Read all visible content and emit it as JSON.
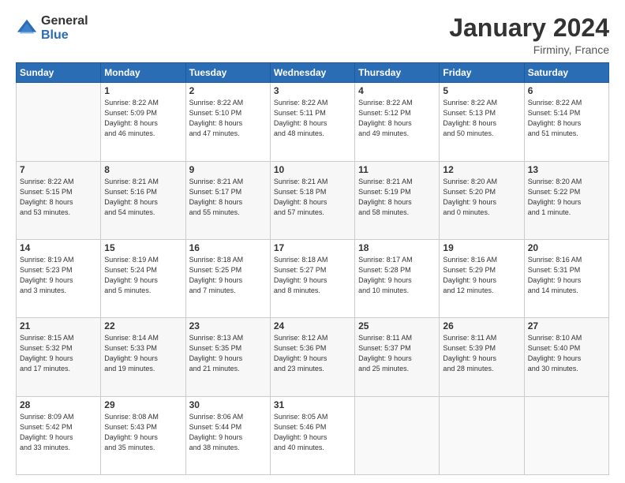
{
  "logo": {
    "general": "General",
    "blue": "Blue"
  },
  "header": {
    "month": "January 2024",
    "location": "Firminy, France"
  },
  "days_of_week": [
    "Sunday",
    "Monday",
    "Tuesday",
    "Wednesday",
    "Thursday",
    "Friday",
    "Saturday"
  ],
  "weeks": [
    [
      {
        "day": "",
        "info": ""
      },
      {
        "day": "1",
        "info": "Sunrise: 8:22 AM\nSunset: 5:09 PM\nDaylight: 8 hours\nand 46 minutes."
      },
      {
        "day": "2",
        "info": "Sunrise: 8:22 AM\nSunset: 5:10 PM\nDaylight: 8 hours\nand 47 minutes."
      },
      {
        "day": "3",
        "info": "Sunrise: 8:22 AM\nSunset: 5:11 PM\nDaylight: 8 hours\nand 48 minutes."
      },
      {
        "day": "4",
        "info": "Sunrise: 8:22 AM\nSunset: 5:12 PM\nDaylight: 8 hours\nand 49 minutes."
      },
      {
        "day": "5",
        "info": "Sunrise: 8:22 AM\nSunset: 5:13 PM\nDaylight: 8 hours\nand 50 minutes."
      },
      {
        "day": "6",
        "info": "Sunrise: 8:22 AM\nSunset: 5:14 PM\nDaylight: 8 hours\nand 51 minutes."
      }
    ],
    [
      {
        "day": "7",
        "info": "Sunrise: 8:22 AM\nSunset: 5:15 PM\nDaylight: 8 hours\nand 53 minutes."
      },
      {
        "day": "8",
        "info": "Sunrise: 8:21 AM\nSunset: 5:16 PM\nDaylight: 8 hours\nand 54 minutes."
      },
      {
        "day": "9",
        "info": "Sunrise: 8:21 AM\nSunset: 5:17 PM\nDaylight: 8 hours\nand 55 minutes."
      },
      {
        "day": "10",
        "info": "Sunrise: 8:21 AM\nSunset: 5:18 PM\nDaylight: 8 hours\nand 57 minutes."
      },
      {
        "day": "11",
        "info": "Sunrise: 8:21 AM\nSunset: 5:19 PM\nDaylight: 8 hours\nand 58 minutes."
      },
      {
        "day": "12",
        "info": "Sunrise: 8:20 AM\nSunset: 5:20 PM\nDaylight: 9 hours\nand 0 minutes."
      },
      {
        "day": "13",
        "info": "Sunrise: 8:20 AM\nSunset: 5:22 PM\nDaylight: 9 hours\nand 1 minute."
      }
    ],
    [
      {
        "day": "14",
        "info": "Sunrise: 8:19 AM\nSunset: 5:23 PM\nDaylight: 9 hours\nand 3 minutes."
      },
      {
        "day": "15",
        "info": "Sunrise: 8:19 AM\nSunset: 5:24 PM\nDaylight: 9 hours\nand 5 minutes."
      },
      {
        "day": "16",
        "info": "Sunrise: 8:18 AM\nSunset: 5:25 PM\nDaylight: 9 hours\nand 7 minutes."
      },
      {
        "day": "17",
        "info": "Sunrise: 8:18 AM\nSunset: 5:27 PM\nDaylight: 9 hours\nand 8 minutes."
      },
      {
        "day": "18",
        "info": "Sunrise: 8:17 AM\nSunset: 5:28 PM\nDaylight: 9 hours\nand 10 minutes."
      },
      {
        "day": "19",
        "info": "Sunrise: 8:16 AM\nSunset: 5:29 PM\nDaylight: 9 hours\nand 12 minutes."
      },
      {
        "day": "20",
        "info": "Sunrise: 8:16 AM\nSunset: 5:31 PM\nDaylight: 9 hours\nand 14 minutes."
      }
    ],
    [
      {
        "day": "21",
        "info": "Sunrise: 8:15 AM\nSunset: 5:32 PM\nDaylight: 9 hours\nand 17 minutes."
      },
      {
        "day": "22",
        "info": "Sunrise: 8:14 AM\nSunset: 5:33 PM\nDaylight: 9 hours\nand 19 minutes."
      },
      {
        "day": "23",
        "info": "Sunrise: 8:13 AM\nSunset: 5:35 PM\nDaylight: 9 hours\nand 21 minutes."
      },
      {
        "day": "24",
        "info": "Sunrise: 8:12 AM\nSunset: 5:36 PM\nDaylight: 9 hours\nand 23 minutes."
      },
      {
        "day": "25",
        "info": "Sunrise: 8:11 AM\nSunset: 5:37 PM\nDaylight: 9 hours\nand 25 minutes."
      },
      {
        "day": "26",
        "info": "Sunrise: 8:11 AM\nSunset: 5:39 PM\nDaylight: 9 hours\nand 28 minutes."
      },
      {
        "day": "27",
        "info": "Sunrise: 8:10 AM\nSunset: 5:40 PM\nDaylight: 9 hours\nand 30 minutes."
      }
    ],
    [
      {
        "day": "28",
        "info": "Sunrise: 8:09 AM\nSunset: 5:42 PM\nDaylight: 9 hours\nand 33 minutes."
      },
      {
        "day": "29",
        "info": "Sunrise: 8:08 AM\nSunset: 5:43 PM\nDaylight: 9 hours\nand 35 minutes."
      },
      {
        "day": "30",
        "info": "Sunrise: 8:06 AM\nSunset: 5:44 PM\nDaylight: 9 hours\nand 38 minutes."
      },
      {
        "day": "31",
        "info": "Sunrise: 8:05 AM\nSunset: 5:46 PM\nDaylight: 9 hours\nand 40 minutes."
      },
      {
        "day": "",
        "info": ""
      },
      {
        "day": "",
        "info": ""
      },
      {
        "day": "",
        "info": ""
      }
    ]
  ]
}
